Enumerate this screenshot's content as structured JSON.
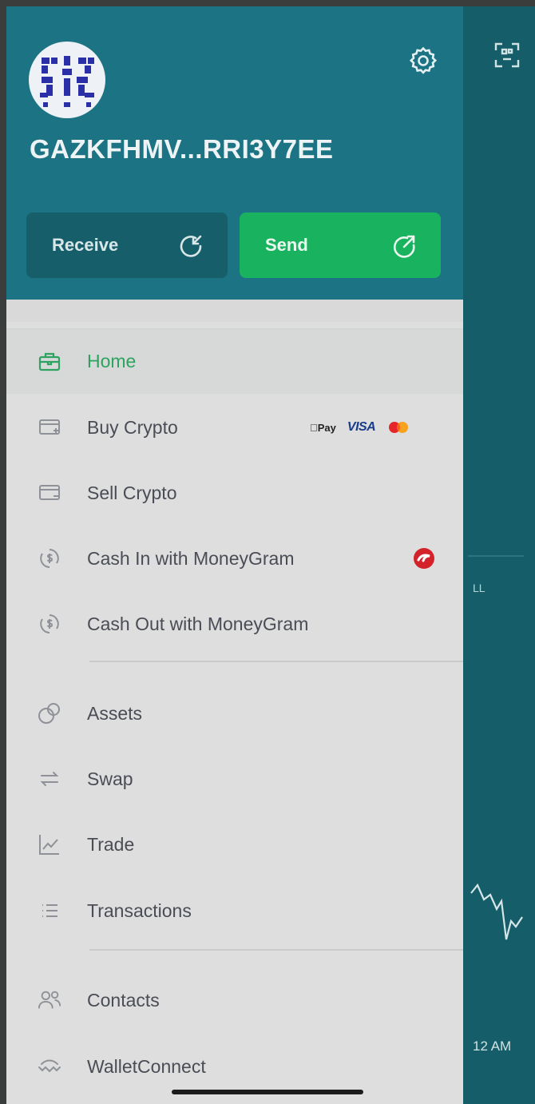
{
  "account": {
    "address": "GAZKFHMV...RRI3Y7EE"
  },
  "actions": {
    "receive": "Receive",
    "send": "Send"
  },
  "menu": {
    "home": "Home",
    "buy_crypto": "Buy Crypto",
    "sell_crypto": "Sell Crypto",
    "cash_in": "Cash In with MoneyGram",
    "cash_out": "Cash Out with MoneyGram",
    "assets": "Assets",
    "swap": "Swap",
    "trade": "Trade",
    "transactions": "Transactions",
    "contacts": "Contacts",
    "walletconnect": "WalletConnect"
  },
  "payment_badges": {
    "apple_pay": "Pay",
    "visa": "VISA"
  },
  "background": {
    "label_fragment": "LL",
    "time_fragment": "12 AM"
  },
  "colors": {
    "header": "#1b7383",
    "send": "#19b35f",
    "receive": "#175e6b",
    "active_label": "#2ea35f",
    "drawer_bg": "#dddedd"
  },
  "icons": {
    "settings": "gear-icon",
    "scan": "qr-scan-icon",
    "receive": "arrow-in-icon",
    "send": "arrow-out-icon"
  }
}
